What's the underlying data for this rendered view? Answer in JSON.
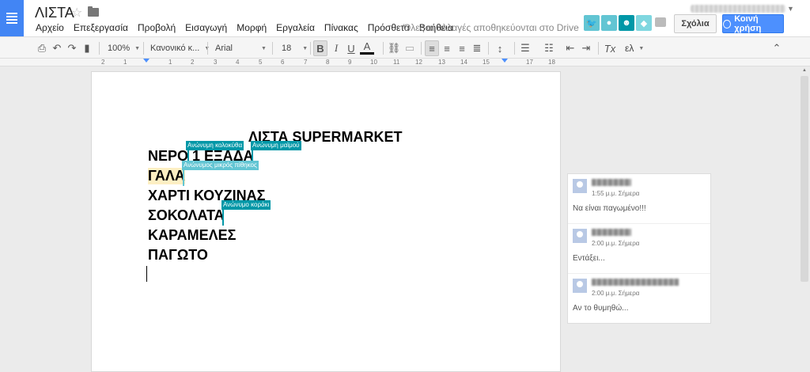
{
  "app": {
    "doc_title": "ΛΙΣΤΑ",
    "save_status": "Όλες οι αλλαγές αποθηκεύονται στο Drive",
    "comments_button": "Σχόλια",
    "share_button": "Κοινή χρήση"
  },
  "menu": [
    "Αρχείο",
    "Επεξεργασία",
    "Προβολή",
    "Εισαγωγή",
    "Μορφή",
    "Εργαλεία",
    "Πίνακας",
    "Πρόσθετα",
    "Βοήθεια"
  ],
  "collaborators": [
    {
      "color": "#62c5d3",
      "icon": "bird-icon"
    },
    {
      "color": "#62c5d3",
      "icon": "dolphin-icon"
    },
    {
      "color": "#0097a7",
      "icon": "monkey-icon"
    },
    {
      "color": "#7fd7e0",
      "icon": "squirrel-icon"
    }
  ],
  "toolbar": {
    "zoom": "100%",
    "style": "Κανονικό κ...",
    "font": "Arial",
    "size": "18",
    "input_tools": "ελ"
  },
  "ruler": {
    "numbers": [
      "2",
      "1",
      "1",
      "2",
      "3",
      "4",
      "5",
      "6",
      "7",
      "8",
      "9",
      "10",
      "11",
      "12",
      "13",
      "14",
      "15",
      "16",
      "17",
      "18"
    ]
  },
  "document": {
    "lines": [
      "ΛΙΣΤΑ SUPERMARKET",
      "ΝΕΡΟ 1 ΕΞΑΔΑ",
      "ΓΑΛΑ",
      "ΧΑΡΤΙ ΚΟΥΖΙΝΑΣ",
      "ΣΟΚΟΛΑΤΑ",
      "ΚΑΡΑΜΕΛΕΣ",
      "ΠΑΓΩΤΟ"
    ]
  },
  "collab_flags": [
    {
      "label": "Ανώνυμη κολοκύθα",
      "color": "#0097a7"
    },
    {
      "label": "Ανώνυμη μαϊμού",
      "color": "#0097a7"
    },
    {
      "label": "Ανώνυμος μικρός πίθηκος",
      "color": "#62c5d3"
    },
    {
      "label": "Ανώνυμο κοράκι",
      "color": "#0097a7"
    }
  ],
  "comments": [
    {
      "time": "1:55 μ.μ. Σήμερα",
      "text": "Να είναι παγωμένο!!!"
    },
    {
      "time": "2:00 μ.μ. Σήμερα",
      "text": "Εντάξει..."
    },
    {
      "time": "2:00 μ.μ. Σήμερα",
      "text": "Αν το θυμηθώ..."
    }
  ]
}
